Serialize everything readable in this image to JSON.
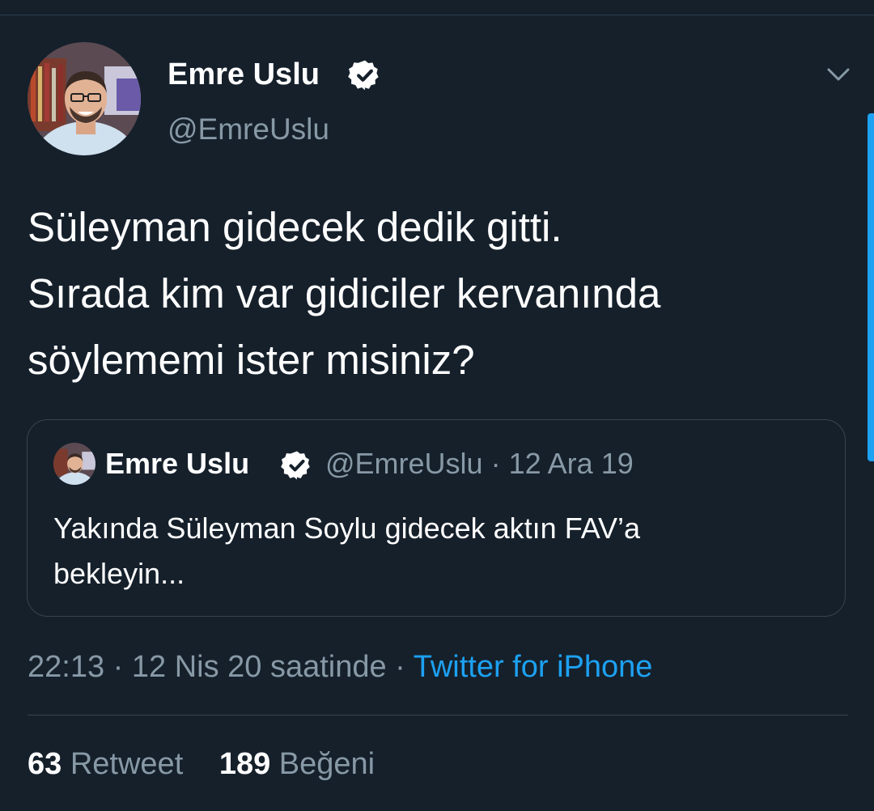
{
  "tweet": {
    "author": {
      "name": "Emre Uslu",
      "handle": "@EmreUslu",
      "verified": true,
      "avatar_icon": "profile-photo"
    },
    "text_lines": [
      "Süleyman gidecek dedik gitti.",
      "Sırada kim var gidiciler kervanında",
      "söylememi ister misiniz?"
    ],
    "quoted": {
      "name": "Emre Uslu",
      "handle": "@EmreUslu",
      "separator": "·",
      "date": "12 Ara 19",
      "text_lines": [
        "Yakında Süleyman Soylu gidecek aktın FAV’a",
        "bekleyin..."
      ]
    },
    "timestamp": "22:13 · 12 Nis 20 saatinde",
    "source_separator": " · ",
    "source": "Twitter for iPhone",
    "stats": {
      "retweets_count": "63",
      "retweets_label": "Retweet",
      "likes_count": "189",
      "likes_label": "Beğeni"
    }
  },
  "colors": {
    "background": "#15202b",
    "primary_text": "#ffffff",
    "secondary_text": "#8899a6",
    "accent": "#1da1f2",
    "border": "#38444d"
  },
  "icons": {
    "verified": "verified-badge-icon",
    "menu": "chevron-down-icon"
  }
}
